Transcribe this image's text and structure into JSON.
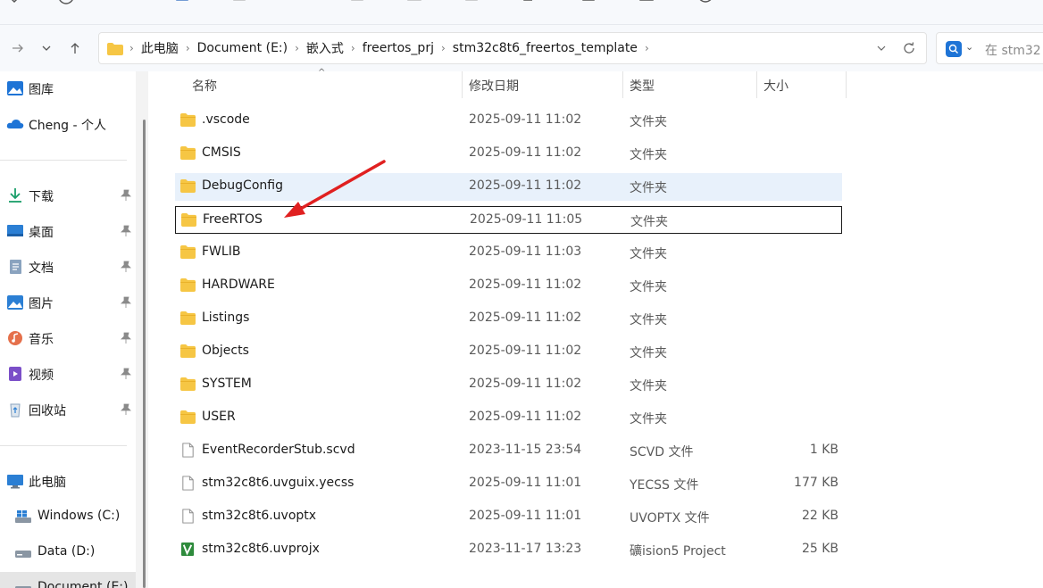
{
  "toolbar": {
    "icons": [
      "chevron-icon",
      "circle-icon",
      "menu-icon",
      "copy-icon",
      "paste-icon",
      "share-icon",
      "rename-icon",
      "crop-icon",
      "delete-icon",
      "new-icon",
      "view-icon",
      "calendar-icon",
      "refresh-icon"
    ]
  },
  "address": {
    "crumbs": [
      "此电脑",
      "Document (E:)",
      "嵌入式",
      "freertos_prj",
      "stm32c8t6_freertos_template"
    ]
  },
  "search": {
    "placeholder": "在 stm32"
  },
  "sidebar": {
    "top": [
      {
        "label": "图库",
        "icon": "gallery-icon"
      },
      {
        "label": "Cheng - 个人",
        "icon": "onedrive-cloud-icon"
      }
    ],
    "pinned": [
      {
        "label": "下载",
        "icon": "download-icon"
      },
      {
        "label": "桌面",
        "icon": "desktop-icon"
      },
      {
        "label": "文档",
        "icon": "documents-icon"
      },
      {
        "label": "图片",
        "icon": "pictures-icon"
      },
      {
        "label": "音乐",
        "icon": "music-icon"
      },
      {
        "label": "视频",
        "icon": "videos-icon"
      },
      {
        "label": "回收站",
        "icon": "recycle-bin-icon"
      }
    ],
    "pc": [
      {
        "label": "此电脑",
        "icon": "this-pc-icon"
      },
      {
        "label": "Windows (C:)",
        "icon": "windows-drive-icon"
      },
      {
        "label": "Data (D:)",
        "icon": "drive-icon"
      },
      {
        "label": "Document (E:)",
        "icon": "drive-icon"
      }
    ]
  },
  "columns": {
    "name": "名称",
    "date": "修改日期",
    "type": "类型",
    "size": "大小"
  },
  "files": [
    {
      "name": ".vscode",
      "date": "2025-09-11 11:02",
      "type": "文件夹",
      "size": "",
      "kind": "folder"
    },
    {
      "name": "CMSIS",
      "date": "2025-09-11 11:02",
      "type": "文件夹",
      "size": "",
      "kind": "folder"
    },
    {
      "name": "DebugConfig",
      "date": "2025-09-11 11:02",
      "type": "文件夹",
      "size": "",
      "kind": "folder"
    },
    {
      "name": "FreeRTOS",
      "date": "2025-09-11 11:05",
      "type": "文件夹",
      "size": "",
      "kind": "folder"
    },
    {
      "name": "FWLIB",
      "date": "2025-09-11 11:03",
      "type": "文件夹",
      "size": "",
      "kind": "folder"
    },
    {
      "name": "HARDWARE",
      "date": "2025-09-11 11:02",
      "type": "文件夹",
      "size": "",
      "kind": "folder"
    },
    {
      "name": "Listings",
      "date": "2025-09-11 11:02",
      "type": "文件夹",
      "size": "",
      "kind": "folder"
    },
    {
      "name": "Objects",
      "date": "2025-09-11 11:02",
      "type": "文件夹",
      "size": "",
      "kind": "folder"
    },
    {
      "name": "SYSTEM",
      "date": "2025-09-11 11:02",
      "type": "文件夹",
      "size": "",
      "kind": "folder"
    },
    {
      "name": "USER",
      "date": "2025-09-11 11:02",
      "type": "文件夹",
      "size": "",
      "kind": "folder"
    },
    {
      "name": "EventRecorderStub.scvd",
      "date": "2023-11-15 23:54",
      "type": "SCVD 文件",
      "size": "1 KB",
      "kind": "file"
    },
    {
      "name": "stm32c8t6.uvguix.yecss",
      "date": "2025-09-11 11:01",
      "type": "YECSS 文件",
      "size": "177 KB",
      "kind": "file"
    },
    {
      "name": "stm32c8t6.uvoptx",
      "date": "2025-09-11 11:01",
      "type": "UVOPTX 文件",
      "size": "22 KB",
      "kind": "file"
    },
    {
      "name": "stm32c8t6.uvprojx",
      "date": "2023-11-17 13:23",
      "type": "礦ision5 Project",
      "size": "25 KB",
      "kind": "keil"
    }
  ],
  "state": {
    "hover_row": "DebugConfig",
    "focus_row": "FreeRTOS",
    "annotation": "red-arrow"
  },
  "colors": {
    "folder": "#f6c644",
    "hover": "#e8f1fb",
    "accent": "#1e74d6",
    "annotation": "#e02020"
  }
}
